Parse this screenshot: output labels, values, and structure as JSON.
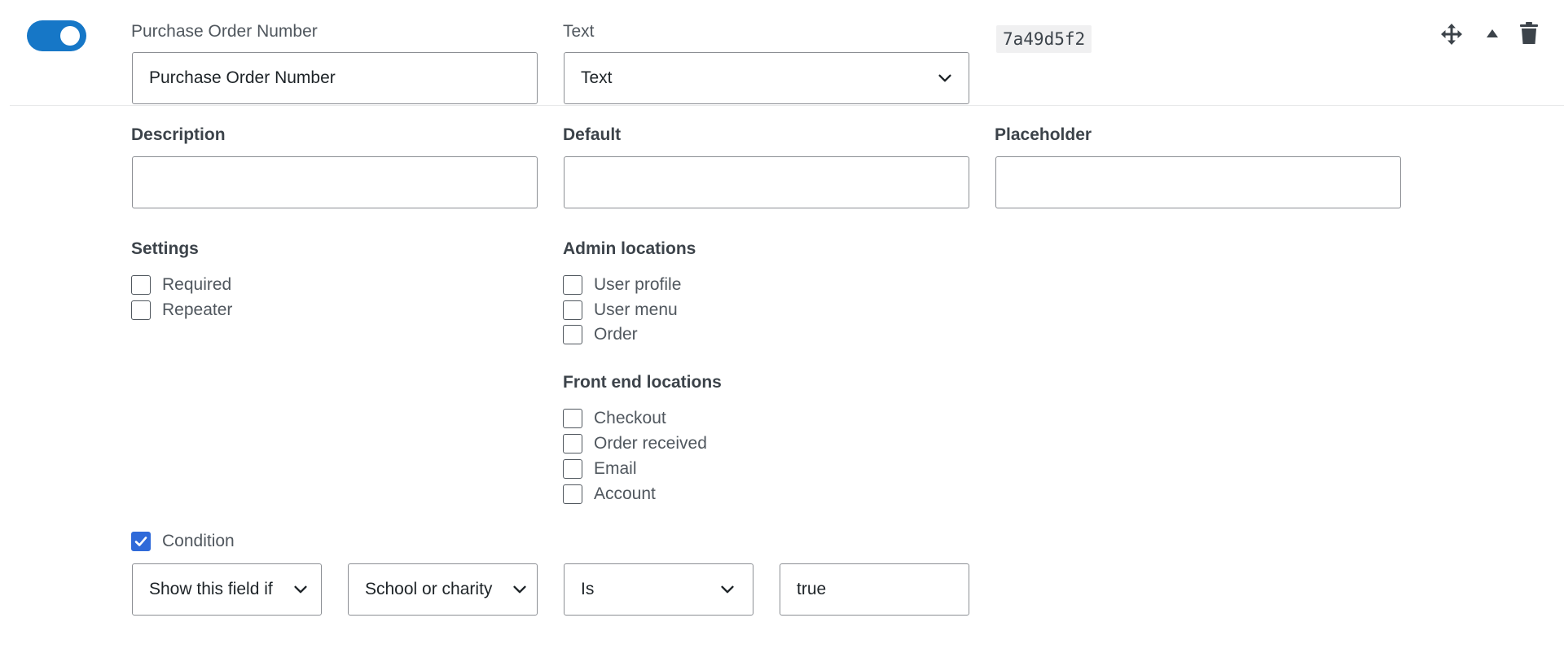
{
  "field": {
    "enabled": true,
    "name_label": "Purchase Order Number",
    "name_value": "Purchase Order Number",
    "type_label": "Text",
    "type_value": "Text",
    "id": "7a49d5f2"
  },
  "actions": {
    "move_icon": "move-arrows-icon",
    "collapse_icon": "triangle-up-icon",
    "delete_icon": "trash-icon"
  },
  "details": {
    "description_label": "Description",
    "description_value": "",
    "default_label": "Default",
    "default_value": "",
    "placeholder_label": "Placeholder",
    "placeholder_value": ""
  },
  "settings": {
    "title": "Settings",
    "options": [
      {
        "label": "Required",
        "checked": false
      },
      {
        "label": "Repeater",
        "checked": false
      }
    ]
  },
  "admin_locations": {
    "title": "Admin locations",
    "options": [
      {
        "label": "User profile",
        "checked": false
      },
      {
        "label": "User menu",
        "checked": false
      },
      {
        "label": "Order",
        "checked": false
      }
    ]
  },
  "front_end_locations": {
    "title": "Front end locations",
    "options": [
      {
        "label": "Checkout",
        "checked": false
      },
      {
        "label": "Order received",
        "checked": false
      },
      {
        "label": "Email",
        "checked": false
      },
      {
        "label": "Account",
        "checked": false
      }
    ]
  },
  "condition": {
    "label": "Condition",
    "checked": true,
    "action_value": "Show this field if",
    "field_value": "School or charity",
    "operator_value": "Is",
    "value": "true"
  },
  "colors": {
    "toggle_on": "#1677c7",
    "checkbox_checked": "#2f6ad9"
  }
}
